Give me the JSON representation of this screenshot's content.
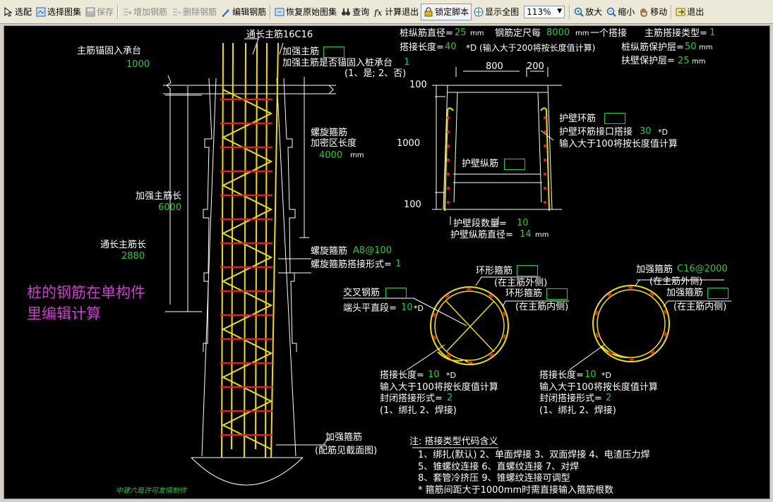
{
  "toolbar": {
    "items": [
      {
        "label": "选配",
        "icon": "select-icon",
        "enabled": true
      },
      {
        "label": "选择图集",
        "icon": "atlas-icon",
        "enabled": true
      },
      {
        "label": "保存",
        "icon": "save-icon",
        "enabled": false
      },
      {
        "label": "增加钢筋",
        "icon": "add-rebar-icon",
        "enabled": false
      },
      {
        "label": "删除钢筋",
        "icon": "delete-rebar-icon",
        "enabled": false
      },
      {
        "label": "编辑钢筋",
        "icon": "edit-rebar-icon",
        "enabled": true
      },
      {
        "label": "恢复原始图集",
        "icon": "restore-icon",
        "enabled": true
      },
      {
        "label": "查询",
        "icon": "binoculars-icon",
        "enabled": true
      },
      {
        "label": "计算退出",
        "icon": "calc-exit-icon",
        "enabled": true
      },
      {
        "label": "锁定脚本",
        "icon": "lock-icon",
        "enabled": true
      },
      {
        "label": "显示全图",
        "icon": "fit-view-icon",
        "enabled": true
      },
      {
        "label": "放大",
        "icon": "zoom-in-icon",
        "enabled": true
      },
      {
        "label": "缩小",
        "icon": "zoom-out-icon",
        "enabled": true
      },
      {
        "label": "移动",
        "icon": "hand-icon",
        "enabled": true
      },
      {
        "label": "退出",
        "icon": "exit-icon",
        "enabled": true
      }
    ],
    "zoom": "113%"
  },
  "drawing": {
    "pile": {
      "through_main_rebar": "通长主筋16C16",
      "anchor_label": "主筋锚固入承台",
      "anchor_value": "1000",
      "reinforce_main": "加强主筋",
      "reinforce_anchor_q": "加强主筋是否锚固入桩承台",
      "reinforce_anchor_val": "1",
      "reinforce_anchor_opts": "(1、是; 2、否)",
      "spiral_dense_l1": "螺旋箍筋",
      "spiral_dense_l2": "加密区长度",
      "spiral_dense_val": "4000",
      "unit_mm": "mm",
      "reinforce_len_label": "加强主筋长",
      "reinforce_len_val": "6000",
      "through_len_label": "通长主筋长",
      "through_len_val": "2880",
      "spiral_label": "螺旋箍筋",
      "spiral_val": "A8@100",
      "spiral_lap_label": "螺旋箍筋搭接形式=",
      "spiral_lap_val": "1",
      "hoop_label": "加强箍筋",
      "hoop_note": "(配筋见截面图)",
      "credit": "中建六局许可友情制作"
    },
    "params": {
      "diameter_label": "桩纵筋直径=",
      "diameter_val": "25",
      "fixed_len_label": "钢筋定尺每",
      "fixed_len_val": "8000",
      "fixed_len_tail": "一个搭接",
      "lap_type_label": "主筋搭接类型=",
      "lap_type_val": "1",
      "lap_len_label": "搭接长度=",
      "lap_len_val": "40",
      "lap_len_note": "*D (输入大于200将按长度值计算)",
      "cover_label": "桩纵筋保护层=",
      "cover_val": "50",
      "wall_cover_label": "扶壁保护层=",
      "wall_cover_val": "25"
    },
    "wall": {
      "dim_800": "800",
      "dim_200": "200",
      "dim_100_top": "100",
      "dim_1000": "1000",
      "dim_100_bottom": "100",
      "ring_label": "护壁环筋",
      "ring_lap_label": "护壁环筋接口搭接",
      "ring_lap_val": "30",
      "ring_lap_unit": "*D",
      "ring_note": "输入大于100将按长度值计算",
      "long_label": "护壁纵筋",
      "count_label": "护壁段数量=",
      "count_val": "10",
      "long_dia_label": "护壁纵筋直径=",
      "long_dia_val": "14"
    },
    "section_left": {
      "ring_hoop": "环形箍筋",
      "outer_note": "(在主筋外侧)",
      "ring_hoop2": "环形箍筋",
      "inner_note": "(在主筋内侧)",
      "cross_label": "交叉钢筋",
      "end_label": "端头平直段=",
      "end_val": "10",
      "end_unit": "*D",
      "lap_len_label": "搭接长度=",
      "lap_len_val": "10",
      "lap_unit": "*D",
      "lap_note": "输入大于100将按长度值计算",
      "close_label": "封闭搭接形式=",
      "close_val": "2",
      "close_opts": "(1、绑扎  2、焊接)"
    },
    "section_right": {
      "hoop_label": "加强箍筋",
      "hoop_val": "C16@2000",
      "outer_note": "(在主筋外侧)",
      "hoop2": "加强箍筋",
      "inner_note": "(在主筋内侧)",
      "lap_len_label": "搭接长度=",
      "lap_len_val": "10",
      "lap_unit": "*D",
      "lap_note": "输入大于100将按长度值计算",
      "close_label": "封闭搭接形式=",
      "close_val": "2",
      "close_opts": "(1、绑扎  2、焊接)"
    },
    "notes": {
      "title": "注: 搭接类型代码含义",
      "line1": "1、绑扎(默认)   2、单面焊接   3、双面焊接   4、电渣压力焊",
      "line2": "5、锥螺纹连接   6、直螺纹连接   7、对焊",
      "line3": "8、套管冷挤压   9、锥螺纹连接可调型",
      "line4": "* 箍筋间距大于1000mm时需直接输入箍筋根数"
    },
    "side_note_l1": "桩的钢筋在单构件",
    "side_note_l2": "里编辑计算"
  },
  "colors": {
    "rebar_yellow": "#f0e000",
    "hoop_red": "#e8201f",
    "text_green": "#2fc83a",
    "note_magenta": "#d23bd2"
  }
}
